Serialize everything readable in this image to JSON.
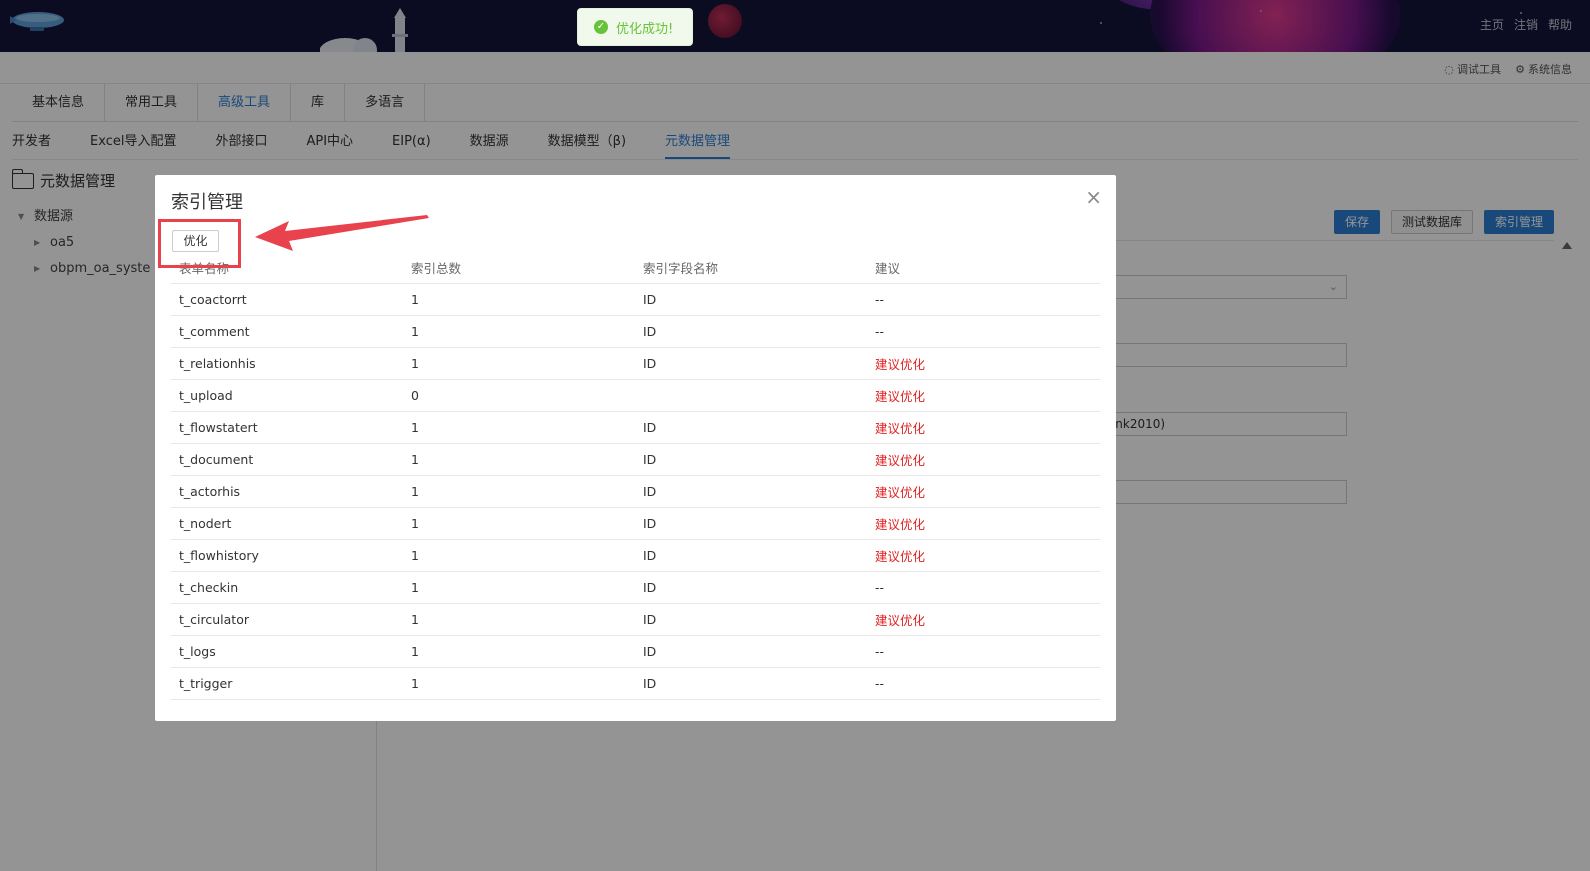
{
  "header": {
    "links": [
      "主页",
      "注销",
      "帮助"
    ]
  },
  "toolbar2": {
    "debug_tools": "调试工具",
    "system_info": "系统信息"
  },
  "main_tabs": [
    {
      "label": "基本信息",
      "active": false
    },
    {
      "label": "常用工具",
      "active": false
    },
    {
      "label": "高级工具",
      "active": true
    },
    {
      "label": "库",
      "active": false
    },
    {
      "label": "多语言",
      "active": false
    }
  ],
  "sub_tabs": [
    {
      "label": "开发者",
      "active": false
    },
    {
      "label": "Excel导入配置",
      "active": false
    },
    {
      "label": "外部接口",
      "active": false
    },
    {
      "label": "API中心",
      "active": false
    },
    {
      "label": "EIP(α)",
      "active": false
    },
    {
      "label": "数据源",
      "active": false
    },
    {
      "label": "数据模型（β)",
      "active": false
    },
    {
      "label": "元数据管理",
      "active": true
    }
  ],
  "left_panel": {
    "title": "元数据管理",
    "tree_root": "数据源",
    "tree_children": [
      "oa5",
      "obpm_oa_syste"
    ]
  },
  "right_panel": {
    "buttons": {
      "save": "保存",
      "test_db": "测试数据库",
      "index_mgmt": "索引管理"
    },
    "field3_value": "nlink2010)"
  },
  "toast": {
    "message": "优化成功!",
    "color": "#67c23a"
  },
  "modal": {
    "title": "索引管理",
    "optimize_button": "优化",
    "columns": [
      "表单名称",
      "索引总数",
      "索引字段名称",
      "建议"
    ],
    "rows": [
      [
        "t_coactorrt",
        "1",
        "ID",
        "--"
      ],
      [
        "t_comment",
        "1",
        "ID",
        "--"
      ],
      [
        "t_relationhis",
        "1",
        "ID",
        "建议优化"
      ],
      [
        "t_upload",
        "0",
        "",
        "建议优化"
      ],
      [
        "t_flowstatert",
        "1",
        "ID",
        "建议优化"
      ],
      [
        "t_document",
        "1",
        "ID",
        "建议优化"
      ],
      [
        "t_actorhis",
        "1",
        "ID",
        "建议优化"
      ],
      [
        "t_nodert",
        "1",
        "ID",
        "建议优化"
      ],
      [
        "t_flowhistory",
        "1",
        "ID",
        "建议优化"
      ],
      [
        "t_checkin",
        "1",
        "ID",
        "--"
      ],
      [
        "t_circulator",
        "1",
        "ID",
        "建议优化"
      ],
      [
        "t_logs",
        "1",
        "ID",
        "--"
      ],
      [
        "t_trigger",
        "1",
        "ID",
        "--"
      ]
    ],
    "warning_color": "#e02020"
  },
  "annotation": {
    "highlight_color": "#e8434c"
  },
  "colors": {
    "accent": "#2b7fd4",
    "header_bg": "#14153a"
  }
}
